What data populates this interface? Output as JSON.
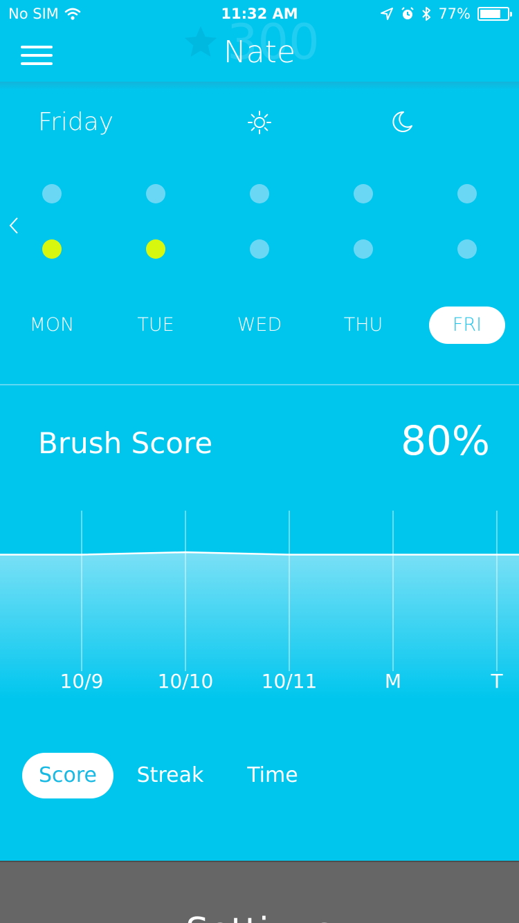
{
  "status_bar": {
    "carrier": "No SIM",
    "time": "11:32 AM",
    "battery_label": "77%",
    "battery_level": 0.77,
    "icons": [
      "wifi-icon",
      "location-arrow-icon",
      "alarm-icon",
      "bluetooth-icon",
      "battery-icon"
    ]
  },
  "header": {
    "title": "Nate",
    "ghost_points": "300",
    "icons": [
      "menu-icon",
      "star-icon"
    ]
  },
  "day_panel": {
    "day_name": "Friday",
    "icons": [
      "sun-icon",
      "moon-icon",
      "chevron-left-icon"
    ],
    "days": [
      {
        "label": "MON",
        "morning": false,
        "evening": true,
        "active": false
      },
      {
        "label": "TUE",
        "morning": false,
        "evening": true,
        "active": false
      },
      {
        "label": "WED",
        "morning": false,
        "evening": false,
        "active": false
      },
      {
        "label": "THU",
        "morning": false,
        "evening": false,
        "active": false
      },
      {
        "label": "FRI",
        "morning": false,
        "evening": false,
        "active": true
      }
    ],
    "colors": {
      "done": "#d8f70e",
      "not_done": "#6ad8f5"
    }
  },
  "score": {
    "title": "Brush Score",
    "value": "80%"
  },
  "chart_data": {
    "type": "area",
    "categories": [
      "10/9",
      "10/10",
      "10/11",
      "M",
      "T"
    ],
    "values": [
      80,
      81,
      80,
      80,
      80
    ],
    "ylim": [
      0,
      100
    ],
    "grid": "vertical"
  },
  "tabs": [
    {
      "label": "Score",
      "active": true
    },
    {
      "label": "Streak",
      "active": false
    },
    {
      "label": "Time",
      "active": false
    }
  ],
  "footer": {
    "settings_label": "Settings"
  },
  "colors": {
    "background": "#00c6ee",
    "accent": "#d8f70e",
    "footer": "#666666"
  }
}
